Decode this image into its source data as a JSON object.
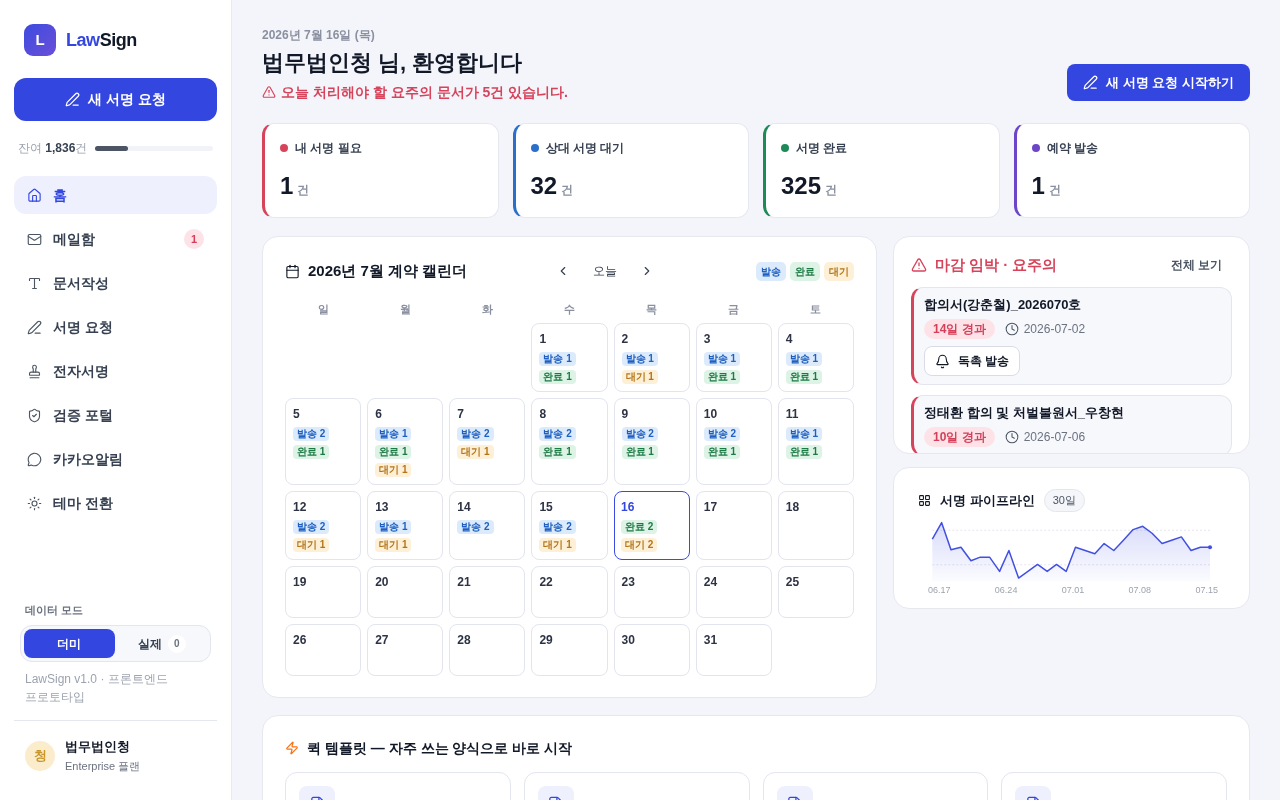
{
  "sidebar": {
    "brand": {
      "initial": "L",
      "name_accent": "Law",
      "name_rest": "Sign"
    },
    "primary_button": "새 서명 요청",
    "quota": {
      "text": "잔여 **1,836**건",
      "level": 0.28
    },
    "nav": [
      {
        "label": "홈",
        "selected": true
      },
      {
        "label": "메일함",
        "selected": false,
        "badge": "1"
      },
      {
        "label": "문서작성",
        "selected": false
      },
      {
        "label": "서명 요청",
        "selected": false
      },
      {
        "label": "전자서명",
        "selected": false
      },
      {
        "label": "검증 포털",
        "selected": false
      },
      {
        "label": "카카오알림",
        "selected": false
      },
      {
        "label": "테마 전환",
        "selected": false
      }
    ],
    "data_mode": {
      "label": "데이터 모드",
      "options": [
        {
          "label": "더미",
          "selected": true
        },
        {
          "label": "실제",
          "selected": false,
          "count": "0"
        }
      ]
    },
    "version": "LawSign v1.0 · 프론트엔드 프로토타입",
    "user": {
      "initial": "청",
      "name": "법무법인청",
      "plan": "Enterprise 플랜"
    }
  },
  "header": {
    "date": "2026년 7월 16일 (목)",
    "title": "법무법인청 님, 환영합니다",
    "alert": "오늘 처리해야 할 요주의 문서가 5건 있습니다.",
    "action_button": "새 서명 요청 시작하기"
  },
  "stats": [
    {
      "label": "내 서명 필요",
      "value": "1",
      "unit": "건",
      "color": "#d6445c"
    },
    {
      "label": "상대 서명 대기",
      "value": "32",
      "unit": "건",
      "color": "#2a6fc9"
    },
    {
      "label": "서명 완료",
      "value": "325",
      "unit": "건",
      "color": "#1e8a57"
    },
    {
      "label": "예약 발송",
      "value": "1",
      "unit": "건",
      "color": "#6c45c8"
    }
  ],
  "calendar": {
    "title": "2026년 7월 계약 캘린더",
    "today_button": "오늘",
    "legend": [
      {
        "kind": "send",
        "label": "발송"
      },
      {
        "kind": "done",
        "label": "완료"
      },
      {
        "kind": "wait",
        "label": "대기"
      }
    ],
    "weekdays": [
      "일",
      "월",
      "화",
      "수",
      "목",
      "금",
      "토"
    ],
    "weeks": [
      [
        {
          "day": "1",
          "selected": false,
          "events": [
            {
              "kind": "send",
              "label": "발송 1"
            },
            {
              "kind": "done",
              "label": "완료 1"
            }
          ]
        },
        {
          "day": "2",
          "selected": false,
          "events": [
            {
              "kind": "send",
              "label": "발송 1"
            },
            {
              "kind": "wait",
              "label": "대기 1"
            }
          ]
        },
        {
          "day": "3",
          "selected": false,
          "events": [
            {
              "kind": "send",
              "label": "발송 1"
            },
            {
              "kind": "done",
              "label": "완료 1"
            }
          ]
        },
        {
          "day": "4",
          "selected": false,
          "events": [
            {
              "kind": "send",
              "label": "발송 1"
            },
            {
              "kind": "done",
              "label": "완료 1"
            }
          ]
        }
      ],
      [
        {
          "day": "5",
          "selected": false,
          "events": [
            {
              "kind": "send",
              "label": "발송 2"
            },
            {
              "kind": "done",
              "label": "완료 1"
            }
          ]
        },
        {
          "day": "6",
          "selected": false,
          "events": [
            {
              "kind": "send",
              "label": "발송 1"
            },
            {
              "kind": "done",
              "label": "완료 1"
            },
            {
              "kind": "wait",
              "label": "대기 1"
            }
          ]
        },
        {
          "day": "7",
          "selected": false,
          "events": [
            {
              "kind": "send",
              "label": "발송 2"
            },
            {
              "kind": "wait",
              "label": "대기 1"
            }
          ]
        },
        {
          "day": "8",
          "selected": false,
          "events": [
            {
              "kind": "send",
              "label": "발송 2"
            },
            {
              "kind": "done",
              "label": "완료 1"
            }
          ]
        },
        {
          "day": "9",
          "selected": false,
          "events": [
            {
              "kind": "send",
              "label": "발송 2"
            },
            {
              "kind": "done",
              "label": "완료 1"
            }
          ]
        },
        {
          "day": "10",
          "selected": false,
          "events": [
            {
              "kind": "send",
              "label": "발송 2"
            },
            {
              "kind": "done",
              "label": "완료 1"
            }
          ]
        },
        {
          "day": "11",
          "selected": false,
          "events": [
            {
              "kind": "send",
              "label": "발송 1"
            },
            {
              "kind": "done",
              "label": "완료 1"
            }
          ]
        }
      ],
      [
        {
          "day": "12",
          "selected": false,
          "events": [
            {
              "kind": "send",
              "label": "발송 2"
            },
            {
              "kind": "wait",
              "label": "대기 1"
            }
          ]
        },
        {
          "day": "13",
          "selected": false,
          "events": [
            {
              "kind": "send",
              "label": "발송 1"
            },
            {
              "kind": "wait",
              "label": "대기 1"
            }
          ]
        },
        {
          "day": "14",
          "selected": false,
          "events": [
            {
              "kind": "send",
              "label": "발송 2"
            }
          ]
        },
        {
          "day": "15",
          "selected": false,
          "events": [
            {
              "kind": "send",
              "label": "발송 2"
            },
            {
              "kind": "wait",
              "label": "대기 1"
            }
          ]
        },
        {
          "day": "16",
          "selected": true,
          "events": [
            {
              "kind": "done",
              "label": "완료 2"
            },
            {
              "kind": "wait",
              "label": "대기 2"
            }
          ]
        },
        {
          "day": "17",
          "selected": false
        },
        {
          "day": "18",
          "selected": false
        }
      ],
      [
        {
          "day": "19",
          "selected": false
        },
        {
          "day": "20",
          "selected": false
        },
        {
          "day": "21",
          "selected": false
        },
        {
          "day": "22",
          "selected": false
        },
        {
          "day": "23",
          "selected": false
        },
        {
          "day": "24",
          "selected": false
        },
        {
          "day": "25",
          "selected": false
        }
      ],
      [
        {
          "day": "26",
          "selected": false
        },
        {
          "day": "27",
          "selected": false
        },
        {
          "day": "28",
          "selected": false
        },
        {
          "day": "29",
          "selected": false
        },
        {
          "day": "30",
          "selected": false
        },
        {
          "day": "31",
          "selected": false
        }
      ]
    ]
  },
  "deadlines": {
    "title": "마감 임박 · 요주의",
    "view_all": "전체 보기",
    "items": [
      {
        "title": "합의서(강춘철)_2026070호",
        "overdue": "14일 경과",
        "date": "2026-07-02",
        "action": "독촉 발송"
      },
      {
        "title": "정태환 합의 및 처벌불원서_우창현",
        "overdue": "10일 경과",
        "date": "2026-07-06"
      }
    ]
  },
  "pipeline": {
    "title": "서명 파이프라인",
    "range": "30일",
    "axis_labels": [
      "06.17",
      "06.24",
      "07.01",
      "07.08",
      "07.15"
    ]
  },
  "quick_templates": {
    "title": "퀵 템플릿 — 자주 쓰는 양식으로 바로 시작",
    "cards": [
      {
        "kind": "document"
      },
      {
        "kind": "document"
      },
      {
        "kind": "document"
      },
      {
        "kind": "document"
      }
    ]
  }
}
